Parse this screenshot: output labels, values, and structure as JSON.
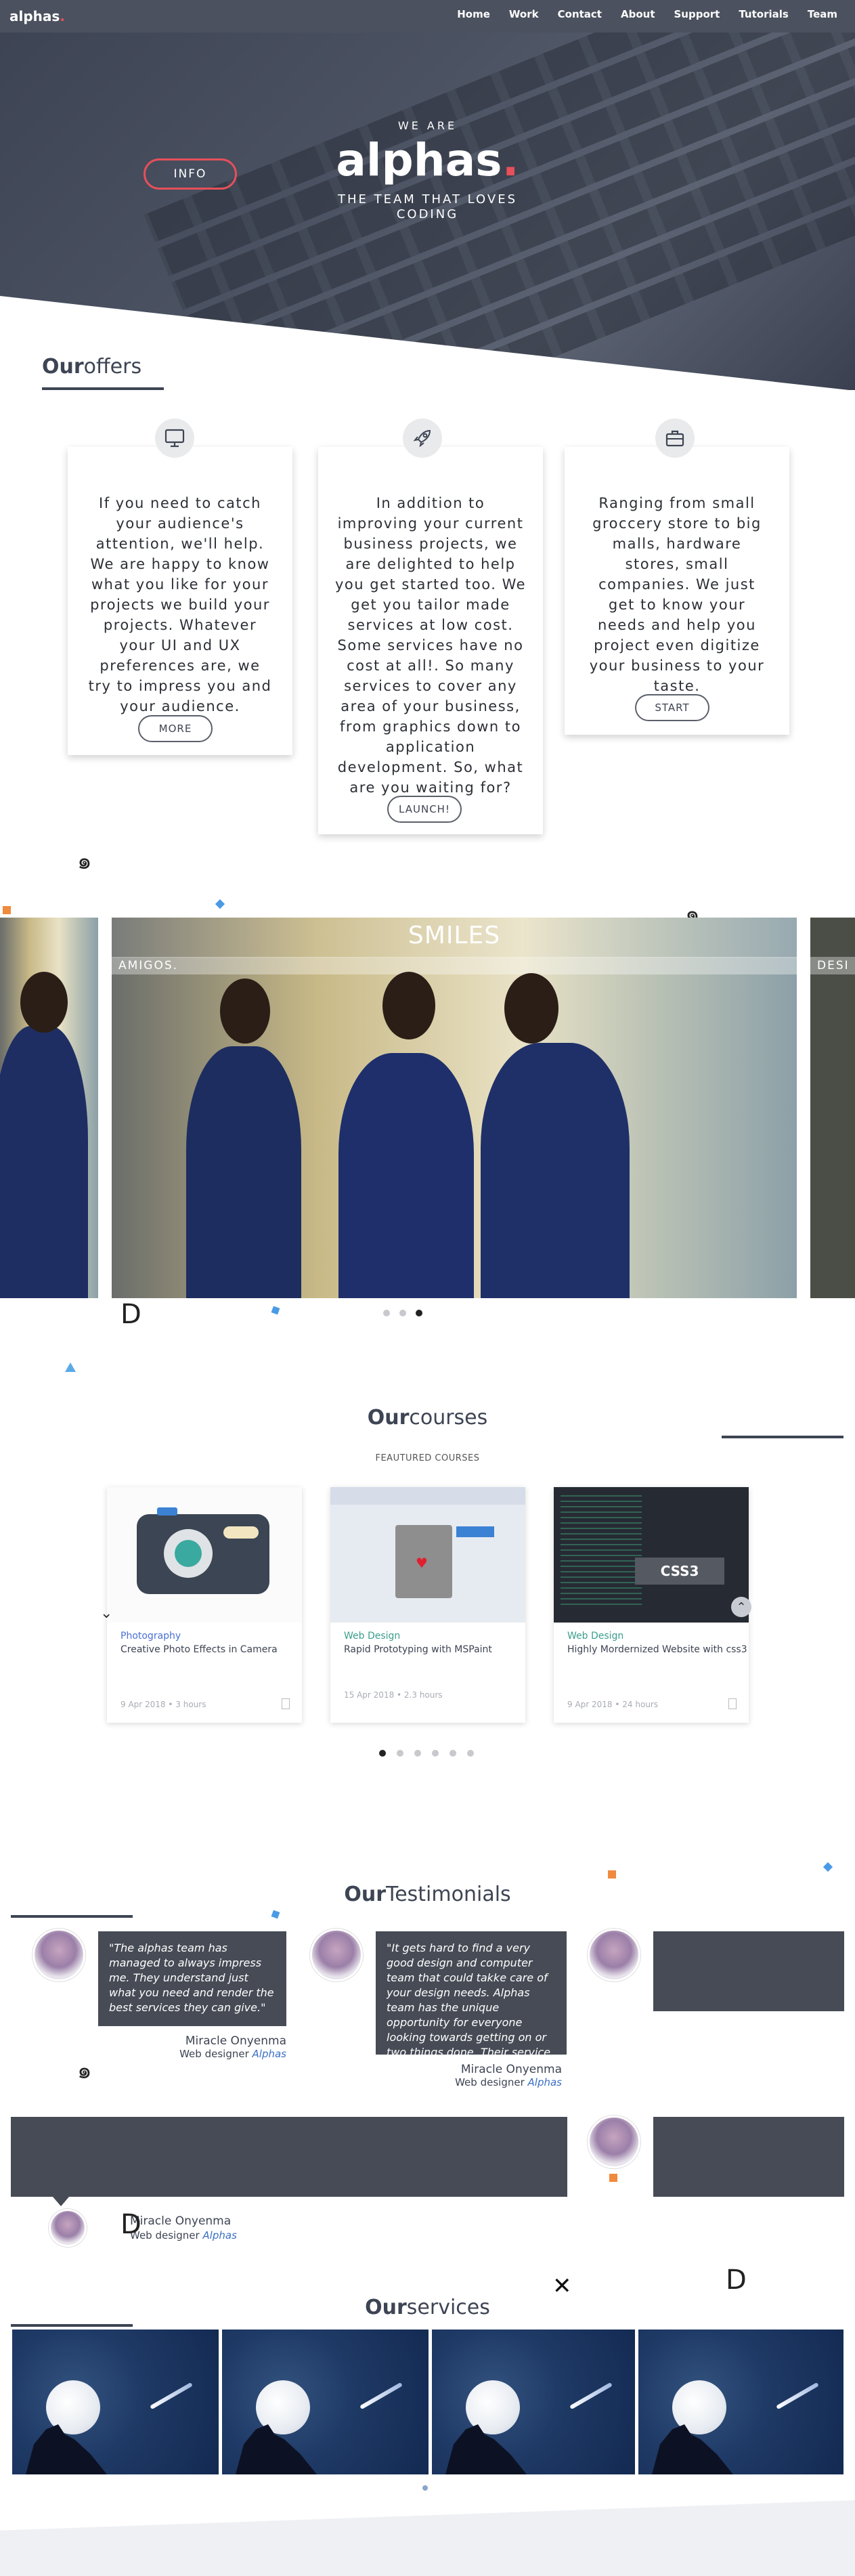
{
  "nav": {
    "logo": "alphas",
    "logo_dot": ".",
    "links": [
      "Home",
      "Work",
      "Contact",
      "About",
      "Support",
      "Tutorials",
      "Team"
    ]
  },
  "hero": {
    "pre": "WE ARE",
    "title": "alphas",
    "title_dot": ".",
    "sub_line1": "THE TEAM THAT LOVES",
    "sub_line2": "CODING",
    "info_button": "INFO"
  },
  "offers": {
    "title_bold": "Our",
    "title_rest": "offers",
    "cards": [
      {
        "icon": "monitor-icon",
        "text": "If you need to catch your audience's attention, we'll help. We are happy to know what you like for your projects we build your projects. Whatever your UI and UX preferences are, we try to impress you and your audience.",
        "button": "MORE"
      },
      {
        "icon": "rocket-icon",
        "text": "In addition to improving your current business projects, we are delighted to help you get started too. We get you tailor made services at low cost. Some services have no cost at all!. So many services to cover any area of your business, from graphics down to application development. So, what are you waiting for?",
        "button": "LAUNCH!"
      },
      {
        "icon": "briefcase-icon",
        "text": "Ranging from small groccery store to big malls, hardware stores, small companies. We just get to know your needs and help you project even digitize your business to your taste.",
        "button": "START"
      }
    ]
  },
  "slider": {
    "main_title": "SMILES",
    "main_caption": "AMIGOS.",
    "right_caption": "DESI",
    "dots": 3,
    "active_dot": 2
  },
  "courses": {
    "title_bold": "Our",
    "title_rest": "courses",
    "subtitle": "FEAUTURED COURSES",
    "items": [
      {
        "category": "Photography",
        "title": "Creative Photo Effects in Camera",
        "date": "9 Apr 2018",
        "duration": "3 hours"
      },
      {
        "category": "Web Design",
        "title": "Rapid Prototyping with MSPaint",
        "date": "15 Apr 2018",
        "duration": "2.3 hours"
      },
      {
        "category": "Web Design",
        "title": "Highly Mordernized Website with css3",
        "date": "9 Apr 2018",
        "duration": "24 hours",
        "badge": "CSS3"
      }
    ],
    "dots": 6,
    "active_dot": 0
  },
  "testimonials": {
    "title_bold": "Our",
    "title_rest": "Testimonials",
    "items": [
      {
        "quote": "\"The alphas team has managed to always impress me. They understand just what you need and render the best services they can give.\"",
        "name": "Miracle Onyenma",
        "role": "Web designer",
        "company": "Alphas"
      },
      {
        "quote": "\"It gets hard to find a very good design and computer team that could takke care of your design needs. Alphas team has the unique opportunity for everyone looking towards getting on or two things done. Their service is superb\"",
        "name": "Miracle Onyenma",
        "role": "Web designer",
        "company": "Alphas"
      },
      {
        "name": "Miracle Onyenma",
        "role": "Web designer",
        "company": "Alphas"
      }
    ]
  },
  "services": {
    "title_bold": "Our",
    "title_rest": "services"
  },
  "colors": {
    "accent": "#e6505a",
    "dark": "#3d4453",
    "bubble": "#464b55",
    "teal": "#3a9e8c"
  }
}
